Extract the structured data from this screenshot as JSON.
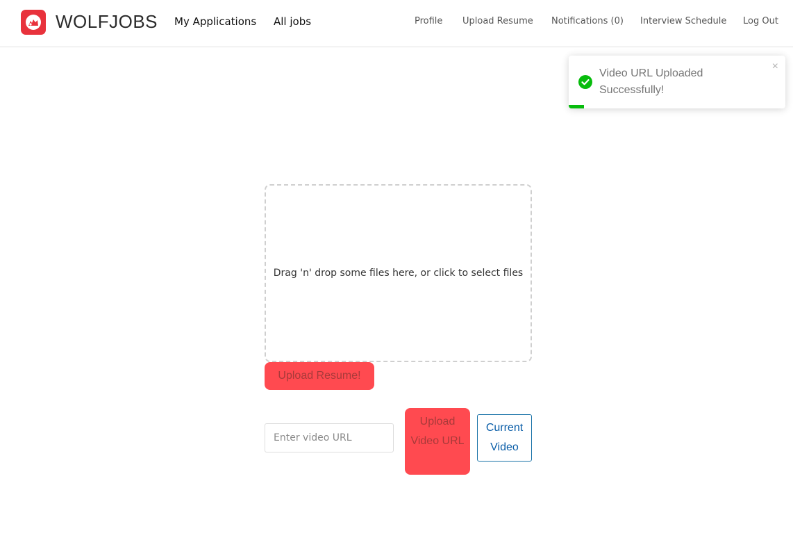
{
  "brand": {
    "name": "WOLFJOBS",
    "logo_icon": "wolf-logo-icon",
    "logo_color": "#e8323c"
  },
  "nav": {
    "left": [
      {
        "label": "My Applications"
      },
      {
        "label": "All jobs"
      }
    ],
    "right": [
      {
        "label": "Profile"
      },
      {
        "label": "Upload Resume"
      },
      {
        "label": "Notifications (0)"
      },
      {
        "label": "Interview Schedule"
      },
      {
        "label": "Log Out"
      }
    ]
  },
  "toast": {
    "message": "Video URL Uploaded Successfully!",
    "icon": "check-circle-icon",
    "close_glyph": "×",
    "accent": "#07bc0c"
  },
  "upload": {
    "dropzone_text": "Drag 'n' drop some files here, or click to select files",
    "upload_resume_label": "Upload Resume!",
    "video_placeholder": "Enter video URL",
    "upload_video_label": "Upload Video URL",
    "current_video_label": "Current Video",
    "button_color": "#ff4a50"
  }
}
